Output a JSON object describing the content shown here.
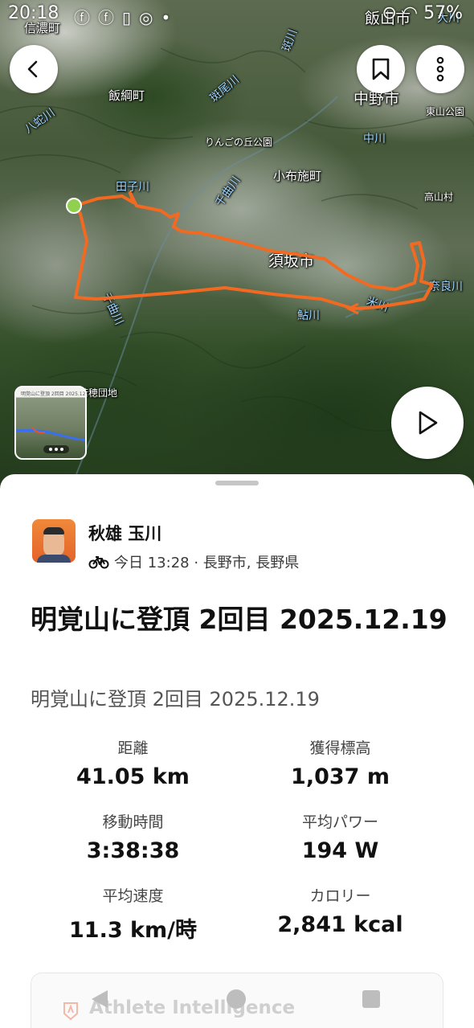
{
  "status_bar": {
    "time": "20:18",
    "battery": "57%",
    "notification_icons": [
      "facebook-icon",
      "facebook-icon",
      "sim-icon",
      "instagram-icon",
      "dot-icon",
      "dnd-icon",
      "wifi-icon"
    ]
  },
  "map": {
    "labels": {
      "shinano": "信濃町",
      "iiyama": "飯山市",
      "okawa": "大川",
      "madarakawa": "斑川",
      "iizuna": "飯綱町",
      "madaraogawa": "斑尾川",
      "nakano": "中野市",
      "higashiyama": "東山公園",
      "hachijagawa": "八蛇川",
      "ringo": "りんごの丘公園",
      "nakagawa": "中川",
      "obuse": "小布施町",
      "takayama": "高山村",
      "tagogawa": "田子川",
      "chikumagawa1": "千曲川",
      "suzaka": "須坂市",
      "narakawa": "奈良川",
      "chikumagawa2": "千曲川",
      "ayukawa": "鮎川",
      "yonekawa": "米川",
      "hotaka": "若穂団地"
    },
    "route_color": "#f26a21",
    "start_marker_color": "#8fd14f"
  },
  "thumbnail": {
    "title": "明覚山に登頂 2回目 2025.12.19"
  },
  "activity": {
    "athlete_name": "秋雄 玉川",
    "meta": "今日 13:28 · 長野市, 長野県",
    "title": "明覚山に登頂 2回目 2025.12.19",
    "description": "明覚山に登頂 2回目 2025.12.19"
  },
  "stats": {
    "distance": {
      "label": "距離",
      "value": "41.05 km"
    },
    "elevation": {
      "label": "獲得標高",
      "value": "1,037 m"
    },
    "moving_time": {
      "label": "移動時間",
      "value": "3:38:38"
    },
    "avg_power": {
      "label": "平均パワー",
      "value": "194 W"
    },
    "avg_speed": {
      "label": "平均速度",
      "value": "11.3 km/時"
    },
    "calories": {
      "label": "カロリー",
      "value": "2,841 kcal"
    }
  },
  "athlete_intelligence": {
    "title": "Athlete Intelligence"
  }
}
